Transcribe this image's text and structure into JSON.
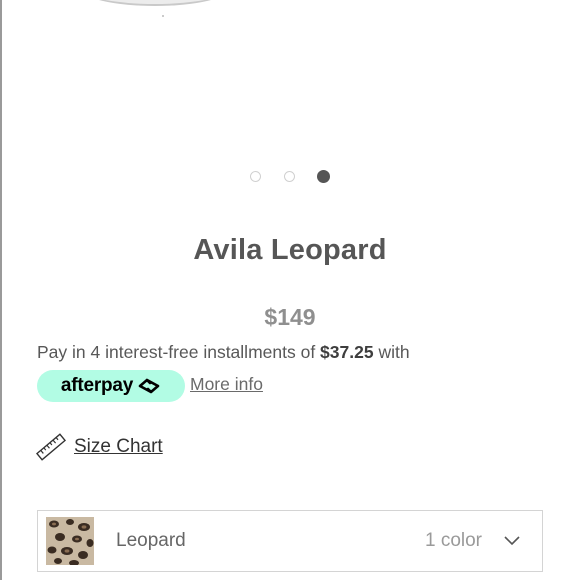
{
  "carousel": {
    "slide_count": 3,
    "active_index": 2
  },
  "product": {
    "title": "Avila Leopard",
    "price": "$149"
  },
  "afterpay": {
    "text_prefix": "Pay in 4 interest-free installments of ",
    "amount": "$37.25",
    "text_suffix": " with",
    "brand": "afterpay",
    "more_info_label": "More info",
    "badge_color": "#b2fce4"
  },
  "size_chart": {
    "label": "Size Chart",
    "icon": "ruler-icon"
  },
  "color_selector": {
    "selected_color": "Leopard",
    "count_label": "1 color",
    "swatch": "leopard-print",
    "icon": "chevron-down-icon"
  }
}
